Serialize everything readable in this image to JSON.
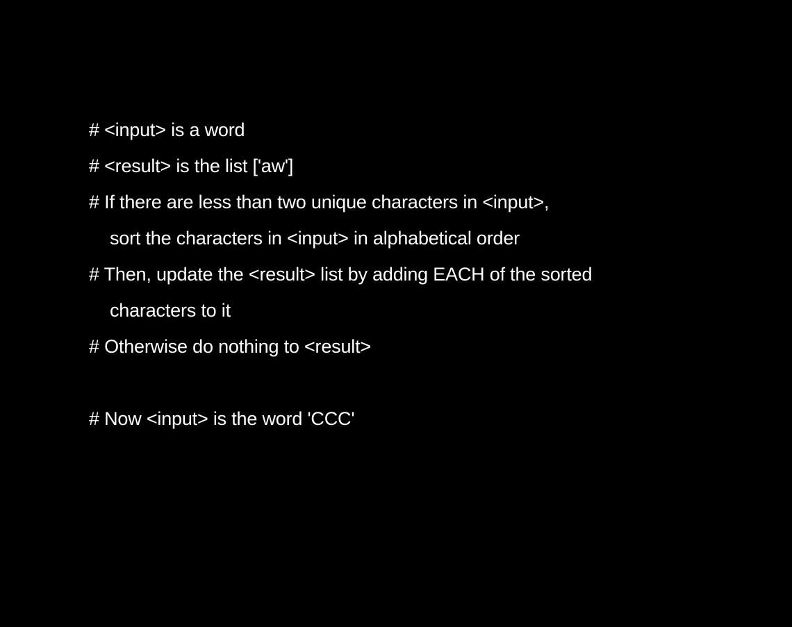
{
  "lines": [
    "# <input> is a word",
    "# <result> is the list ['aw']",
    "# If there are less than two unique characters in <input>,",
    "sort the characters in <input> in alphabetical order",
    "# Then, update the <result> list by adding EACH of the sorted",
    "characters to it",
    "# Otherwise do nothing to <result>",
    "",
    "# Now <input> is the word 'CCC'"
  ],
  "colors": {
    "background": "#000000",
    "text": "#ffffff"
  }
}
